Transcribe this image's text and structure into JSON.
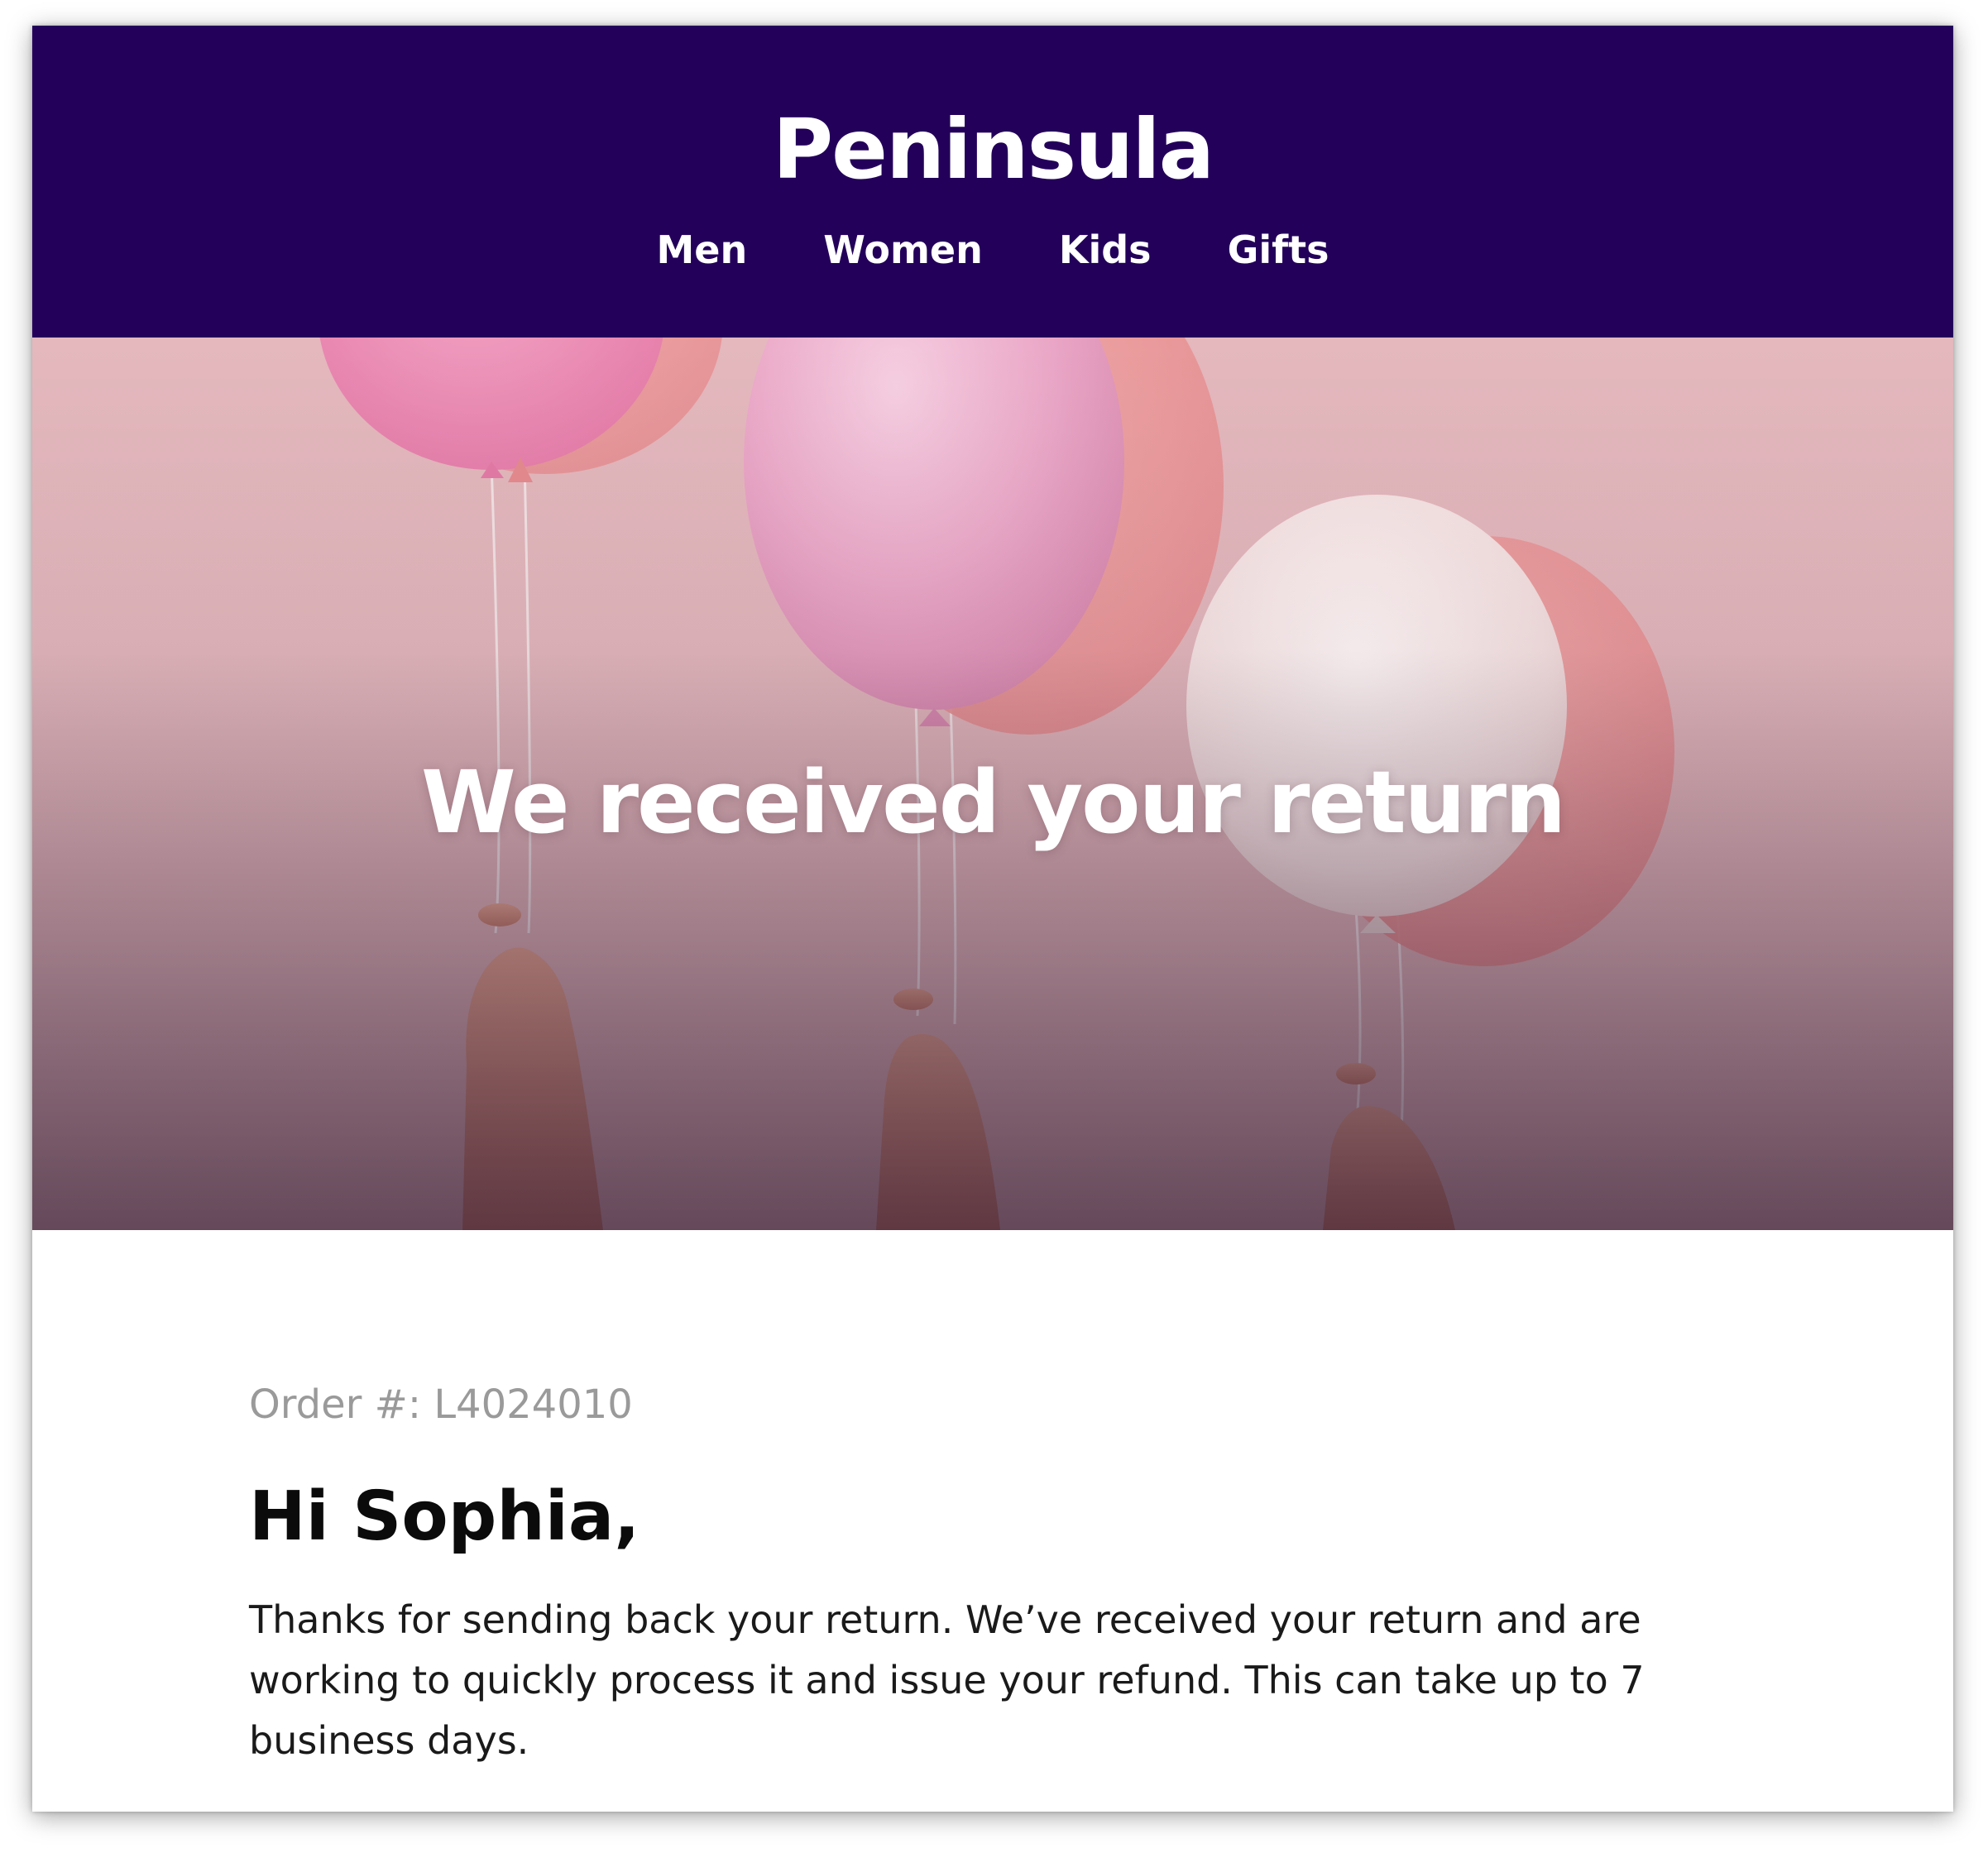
{
  "brand": {
    "name": "Peninsula"
  },
  "nav": {
    "items": [
      "Men",
      "Women",
      "Kids",
      "Gifts"
    ]
  },
  "hero": {
    "title": "We received your return"
  },
  "order": {
    "label": "Order #: L4024010"
  },
  "greeting": "Hi Sophia,",
  "message": "Thanks for sending back your return. We’ve received your return and are working to quickly process it and issue your refund. This can take up to 7 business days.",
  "colors": {
    "header_bg": "#23005a",
    "hero_bg": "#e7bcc0",
    "text_dark": "#0b0b0b",
    "text_muted": "#9a9a9a"
  }
}
